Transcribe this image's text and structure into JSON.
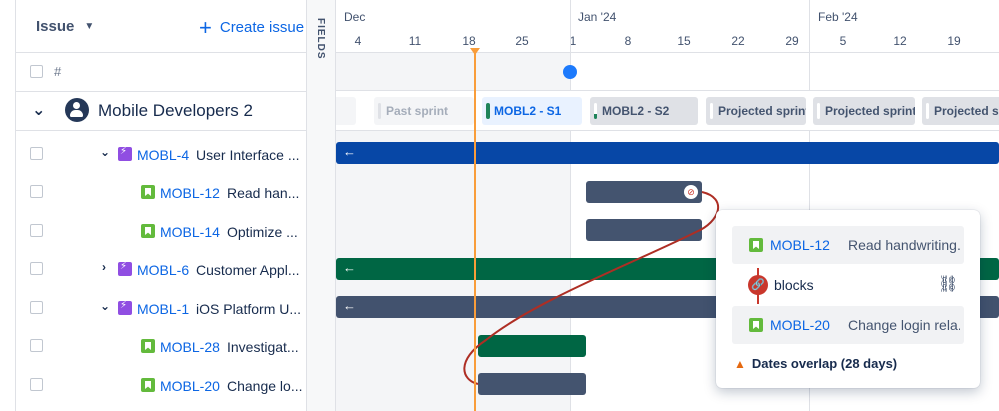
{
  "left_header": {
    "issue_label": "Issue",
    "create_issue_label": "Create issue"
  },
  "columns": {
    "hash_label": "#"
  },
  "fields_label": "FIELDS",
  "team": {
    "name": "Mobile Developers 2"
  },
  "issues": [
    {
      "key": "MOBL-4",
      "summary": "User Interface ...",
      "type": "epic",
      "expander": "down"
    },
    {
      "key": "MOBL-12",
      "summary": "Read han...",
      "type": "story"
    },
    {
      "key": "MOBL-14",
      "summary": "Optimize ...",
      "type": "story"
    },
    {
      "key": "MOBL-6",
      "summary": "Customer Appl...",
      "type": "epic",
      "expander": "right"
    },
    {
      "key": "MOBL-1",
      "summary": "iOS Platform U...",
      "type": "epic",
      "expander": "down"
    },
    {
      "key": "MOBL-28",
      "summary": "Investigat...",
      "type": "story"
    },
    {
      "key": "MOBL-20",
      "summary": "Change lo...",
      "type": "story"
    }
  ],
  "timeline": {
    "months": [
      "Dec",
      "Jan '24",
      "Feb '24"
    ],
    "days": [
      "4",
      "11",
      "18",
      "25",
      "1",
      "8",
      "15",
      "22",
      "29",
      "5",
      "12",
      "19"
    ],
    "sprints": [
      "Past sprint",
      "MOBL2 - S1",
      "MOBL2 - S2",
      "Projected sprint",
      "Projected sprint",
      "Projected sp"
    ]
  },
  "popup": {
    "from": {
      "key": "MOBL-12",
      "summary": "Read handwriting..."
    },
    "link_type": "blocks",
    "to": {
      "key": "MOBL-20",
      "summary": "Change login rela..."
    },
    "warning": "Dates overlap (28 days)"
  },
  "colors": {
    "epic_blue": "#0747a6",
    "epic_green": "#006644",
    "epic_slate": "#42526e",
    "story_bar": "#44546f",
    "today": "#f99d3a",
    "dependency": "#ae2e24"
  },
  "icons": {
    "issue_sort": "chevron-down-icon",
    "create": "plus-icon",
    "team": "team-avatar-icon",
    "epic": "lightning-icon",
    "story": "bookmark-icon",
    "link": "link-icon",
    "unlink": "unlink-icon",
    "warning": "warning-icon"
  }
}
